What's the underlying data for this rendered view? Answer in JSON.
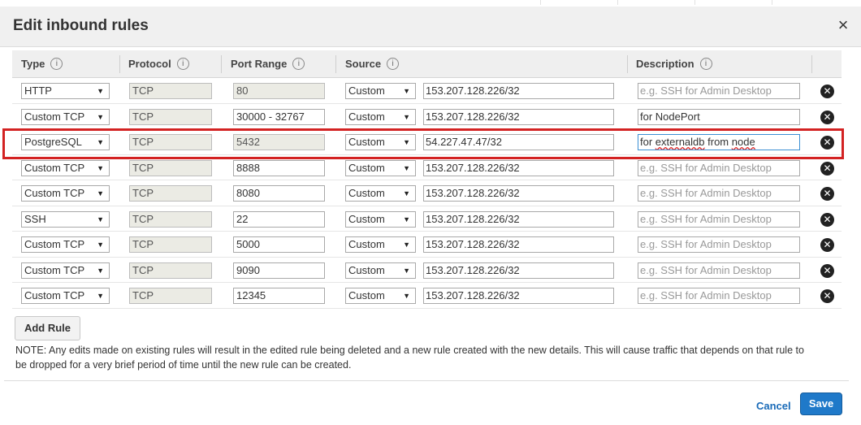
{
  "dialog": {
    "title": "Edit inbound rules",
    "close_glyph": "×"
  },
  "columns": {
    "type": "Type",
    "protocol": "Protocol",
    "port_range": "Port Range",
    "source": "Source",
    "description": "Description",
    "info_glyph": "i"
  },
  "rules": [
    {
      "type": "HTTP",
      "protocol": "TCP",
      "port": "80",
      "source": "Custom",
      "cidr": "153.207.128.226/32",
      "description": "",
      "placeholder": "e.g. SSH for Admin Desktop"
    },
    {
      "type": "Custom TCP",
      "protocol": "TCP",
      "port": "30000 - 32767",
      "source": "Custom",
      "cidr": "153.207.128.226/32",
      "description": "for NodePort",
      "placeholder": "e.g. SSH for Admin Desktop"
    },
    {
      "type": "PostgreSQL",
      "protocol": "TCP",
      "port": "5432",
      "source": "Custom",
      "cidr": "54.227.47.47/32",
      "description": "for externaldb from node",
      "placeholder": "e.g. SSH for Admin Desktop",
      "highlighted": true
    },
    {
      "type": "Custom TCP",
      "protocol": "TCP",
      "port": "8888",
      "source": "Custom",
      "cidr": "153.207.128.226/32",
      "description": "",
      "placeholder": "e.g. SSH for Admin Desktop"
    },
    {
      "type": "Custom TCP",
      "protocol": "TCP",
      "port": "8080",
      "source": "Custom",
      "cidr": "153.207.128.226/32",
      "description": "",
      "placeholder": "e.g. SSH for Admin Desktop"
    },
    {
      "type": "SSH",
      "protocol": "TCP",
      "port": "22",
      "source": "Custom",
      "cidr": "153.207.128.226/32",
      "description": "",
      "placeholder": "e.g. SSH for Admin Desktop"
    },
    {
      "type": "Custom TCP",
      "protocol": "TCP",
      "port": "5000",
      "source": "Custom",
      "cidr": "153.207.128.226/32",
      "description": "",
      "placeholder": "e.g. SSH for Admin Desktop"
    },
    {
      "type": "Custom TCP",
      "protocol": "TCP",
      "port": "9090",
      "source": "Custom",
      "cidr": "153.207.128.226/32",
      "description": "",
      "placeholder": "e.g. SSH for Admin Desktop"
    },
    {
      "type": "Custom TCP",
      "protocol": "TCP",
      "port": "12345",
      "source": "Custom",
      "cidr": "153.207.128.226/32",
      "description": "",
      "placeholder": "e.g. SSH for Admin Desktop"
    }
  ],
  "icons": {
    "dropdown_arrow": "▼",
    "delete_glyph": "✕"
  },
  "add_rule_label": "Add Rule",
  "note": "NOTE: Any edits made on existing rules will result in the edited rule being deleted and a new rule created with the new details. This will cause traffic that depends on that rule to be dropped for a very brief period of time until the new rule can be created.",
  "footer": {
    "cancel_label": "Cancel",
    "save_label": "Save"
  },
  "colors": {
    "highlight_border": "#d32222",
    "primary_button": "#1f79c9",
    "link": "#1a6bb8"
  }
}
